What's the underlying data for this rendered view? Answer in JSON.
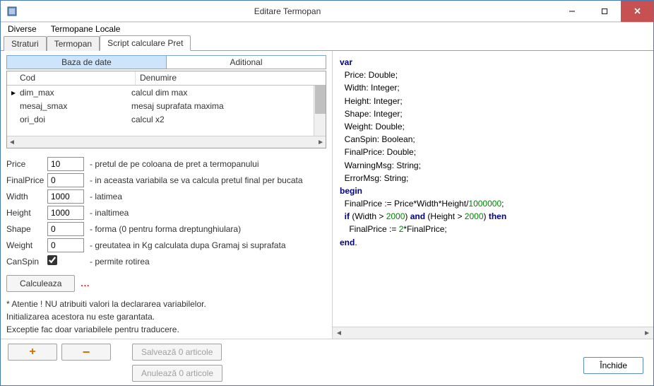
{
  "window": {
    "title": "Editare Termopan"
  },
  "menu": {
    "diverse": "Diverse",
    "local": "Termopane Locale"
  },
  "tabs": {
    "straturi": "Straturi",
    "termopan": "Termopan",
    "script": "Script calculare Pret"
  },
  "subtabs": {
    "db": "Baza de date",
    "add": "Aditional"
  },
  "grid": {
    "head_cod": "Cod",
    "head_den": "Denumire",
    "rows": [
      {
        "cod": "dim_max",
        "den": "calcul dim max"
      },
      {
        "cod": "mesaj_smax",
        "den": "mesaj suprafata maxima"
      },
      {
        "cod": "ori_doi",
        "den": "calcul x2"
      }
    ]
  },
  "form": {
    "price": {
      "label": "Price",
      "value": "10",
      "desc": "- pretul de pe coloana de pret a termopanului"
    },
    "finalprice": {
      "label": "FinalPrice",
      "value": "0",
      "desc": "- in aceasta variabila se va calcula pretul final per bucata"
    },
    "width": {
      "label": "Width",
      "value": "1000",
      "desc": "- latimea"
    },
    "height": {
      "label": "Height",
      "value": "1000",
      "desc": "- inaltimea"
    },
    "shape": {
      "label": "Shape",
      "value": "0",
      "desc": "- forma (0 pentru forma dreptunghiulara)"
    },
    "weight": {
      "label": "Weight",
      "value": "0",
      "desc": "- greutatea in Kg calculata dupa Gramaj si suprafata"
    },
    "canspin": {
      "label": "CanSpin",
      "desc": "- permite rotirea"
    }
  },
  "calc": {
    "button": "Calculeaza",
    "dots": "..."
  },
  "notes": {
    "l1": "* Atentie ! NU atribuiti valori la declararea variabilelor.",
    "l2": "Initializarea acestora nu este garantata.",
    "l3": "Exceptie fac doar variabilele pentru traducere."
  },
  "code": {
    "var": "var",
    "l1": "  Price: Double;",
    "l2": "  Width: Integer;",
    "l3": "  Height: Integer;",
    "l4": "  Shape: Integer;",
    "l5": "  Weight: Double;",
    "l6": "  CanSpin: Boolean;",
    "l7": "  FinalPrice: Double;",
    "l8": "  WarningMsg: String;",
    "l9": "  ErrorMsg: String;",
    "begin": "begin",
    "b1a": "  FinalPrice := Price*Width*Height/",
    "b1num": "1000000",
    "b1b": ";",
    "b2a": "  ",
    "b2if": "if",
    "b2b": " (Width > ",
    "b2n1": "2000",
    "b2c": ") ",
    "b2and": "and",
    "b2d": " (Height > ",
    "b2n2": "2000",
    "b2e": ") ",
    "b2then": "then",
    "b3a": "    FinalPrice := ",
    "b3n": "2",
    "b3b": "*FinalPrice;",
    "end": "end",
    "enddot": "."
  },
  "footer": {
    "save": "Salvează 0 articole",
    "cancel": "Anulează 0 articole",
    "close": "Închide"
  }
}
